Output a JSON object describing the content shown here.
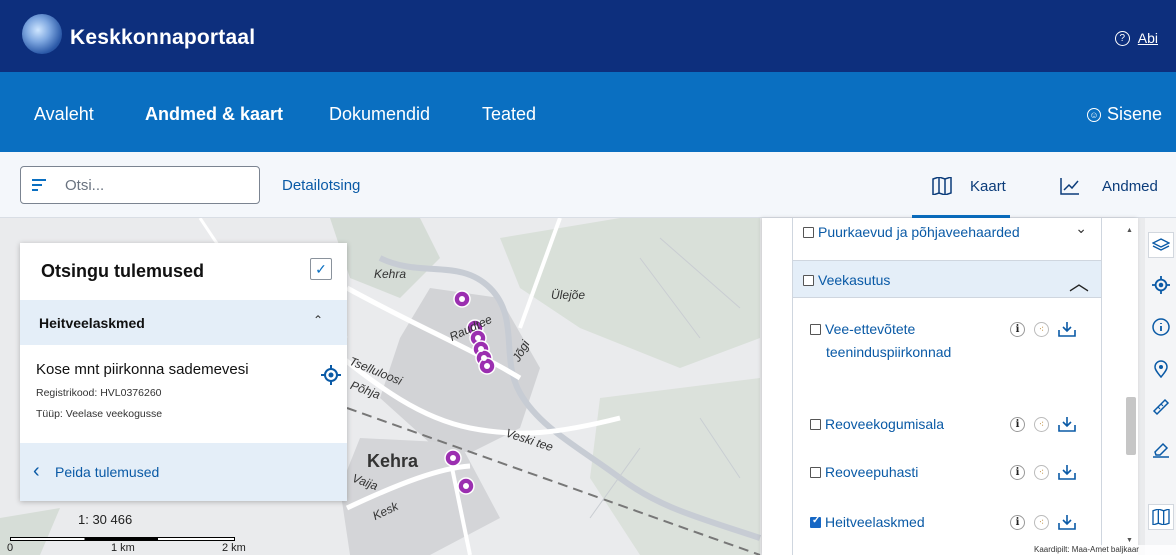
{
  "header": {
    "brand": "Keskkonnaportaal",
    "help_label": "Abi"
  },
  "nav": {
    "items": [
      "Avaleht",
      "Andmed & kaart",
      "Dokumendid",
      "Teated"
    ],
    "signin": "Sisene"
  },
  "search": {
    "placeholder": "Otsi...",
    "detail_link": "Detailotsing",
    "view_map": "Kaart",
    "view_data": "Andmed"
  },
  "map": {
    "places": [
      "Kehra",
      "Ülejõe",
      "Kehra",
      "Tselluloosi",
      "Raudtee",
      "Jõgi",
      "Veski",
      "Põhja",
      "Vaija",
      "Kesk",
      "Veski tee"
    ],
    "scale_ratio": "1: 30 466",
    "scale_labels": [
      "0",
      "1 km",
      "2 km"
    ],
    "attribution": "Kaardipilt: Maa-Amet baljkaar"
  },
  "results": {
    "title": "Otsingu tulemused",
    "group": "Heitveelaskmed",
    "item": {
      "name": "Kose mnt piirkonna sademevesi",
      "reg_label": "Registrikood:",
      "reg_value": "HVL0376260",
      "type_label": "Tüüp:",
      "type_value": "Veelase veekogusse"
    },
    "hide_label": "Peida tulemused"
  },
  "layers": {
    "top_item": "Puurkaevud ja põhjaveehaarded",
    "parent": "Veekasutus",
    "children": [
      {
        "label_lines": [
          "Vee-ettevõtete",
          "teeninduspiirkonnad"
        ],
        "checked": false
      },
      {
        "label_lines": [
          "Reoveekogumisala"
        ],
        "checked": false
      },
      {
        "label_lines": [
          "Reoveepuhasti"
        ],
        "checked": false
      },
      {
        "label_lines": [
          "Heitveelaskmed"
        ],
        "checked": true
      }
    ]
  },
  "colors": {
    "topbar": "#0d2f7d",
    "navbar": "#0a6fc1",
    "accent": "#0a5aa6",
    "marker": "#9b2fb0"
  },
  "toolbar_icons": [
    "layers-icon",
    "locate-icon",
    "info-icon",
    "pin-icon",
    "ruler-icon",
    "eraser-icon",
    "map-icon"
  ]
}
